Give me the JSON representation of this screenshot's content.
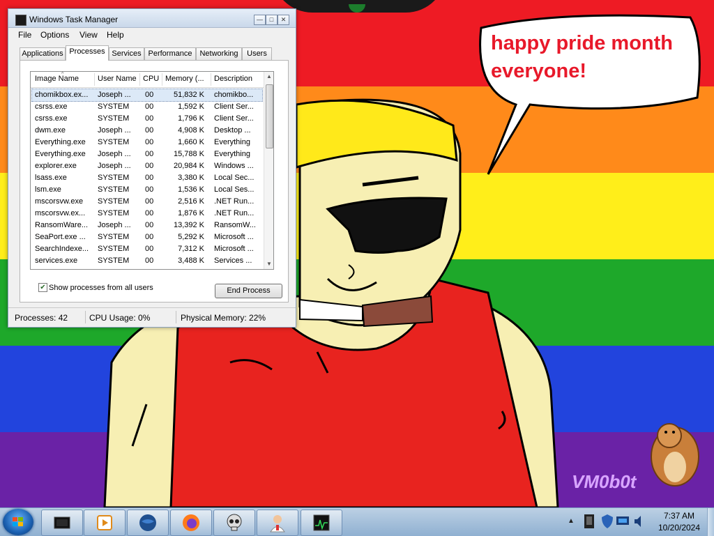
{
  "desktop": {
    "bubble_text": "happy pride month everyone!",
    "watermark": "VM0b0t",
    "stripe_colors": [
      "#ee1b24",
      "#ff8a1a",
      "#ffee1a",
      "#1ea82a",
      "#2244dd",
      "#6a22a6"
    ]
  },
  "task_manager": {
    "title": "Windows Task Manager",
    "menu": [
      "File",
      "Options",
      "View",
      "Help"
    ],
    "tabs": [
      "Applications",
      "Processes",
      "Services",
      "Performance",
      "Networking",
      "Users"
    ],
    "active_tab": "Processes",
    "columns": [
      "Image Name",
      "User Name",
      "CPU",
      "Memory (...",
      "Description"
    ],
    "rows": [
      {
        "image": "chomikbox.ex...",
        "user": "Joseph ...",
        "cpu": "00",
        "memory": "51,832 K",
        "description": "chomikbo..."
      },
      {
        "image": "csrss.exe",
        "user": "SYSTEM",
        "cpu": "00",
        "memory": "1,592 K",
        "description": "Client Ser..."
      },
      {
        "image": "csrss.exe",
        "user": "SYSTEM",
        "cpu": "00",
        "memory": "1,796 K",
        "description": "Client Ser..."
      },
      {
        "image": "dwm.exe",
        "user": "Joseph ...",
        "cpu": "00",
        "memory": "4,908 K",
        "description": "Desktop ..."
      },
      {
        "image": "Everything.exe",
        "user": "SYSTEM",
        "cpu": "00",
        "memory": "1,660 K",
        "description": "Everything"
      },
      {
        "image": "Everything.exe",
        "user": "Joseph ...",
        "cpu": "00",
        "memory": "15,788 K",
        "description": "Everything"
      },
      {
        "image": "explorer.exe",
        "user": "Joseph ...",
        "cpu": "00",
        "memory": "20,984 K",
        "description": "Windows ..."
      },
      {
        "image": "lsass.exe",
        "user": "SYSTEM",
        "cpu": "00",
        "memory": "3,380 K",
        "description": "Local Sec..."
      },
      {
        "image": "lsm.exe",
        "user": "SYSTEM",
        "cpu": "00",
        "memory": "1,536 K",
        "description": "Local Ses..."
      },
      {
        "image": "mscorsvw.exe",
        "user": "SYSTEM",
        "cpu": "00",
        "memory": "2,516 K",
        "description": ".NET Run..."
      },
      {
        "image": "mscorsvw.ex...",
        "user": "SYSTEM",
        "cpu": "00",
        "memory": "1,876 K",
        "description": ".NET Run..."
      },
      {
        "image": "RansomWare...",
        "user": "Joseph ...",
        "cpu": "00",
        "memory": "13,392 K",
        "description": "RansomW..."
      },
      {
        "image": "SeaPort.exe ...",
        "user": "SYSTEM",
        "cpu": "00",
        "memory": "5,292 K",
        "description": "Microsoft ..."
      },
      {
        "image": "SearchIndexe...",
        "user": "SYSTEM",
        "cpu": "00",
        "memory": "7,312 K",
        "description": "Microsoft ..."
      },
      {
        "image": "services.exe",
        "user": "SYSTEM",
        "cpu": "00",
        "memory": "3,488 K",
        "description": "Services ..."
      }
    ],
    "show_all_label": "Show processes from all users",
    "show_all_checked": true,
    "end_process_label": "End Process",
    "status": {
      "processes": "Processes: 42",
      "cpu": "CPU Usage: 0%",
      "memory": "Physical Memory: 22%"
    }
  },
  "taskbar": {
    "icons": [
      "start-orb-icon",
      "computer-icon",
      "media-player-icon",
      "globe-icon",
      "firefox-icon",
      "skull-icon",
      "doctor-icon",
      "task-manager-icon"
    ],
    "clock_time": "7:37 AM",
    "clock_date": "10/20/2024"
  }
}
